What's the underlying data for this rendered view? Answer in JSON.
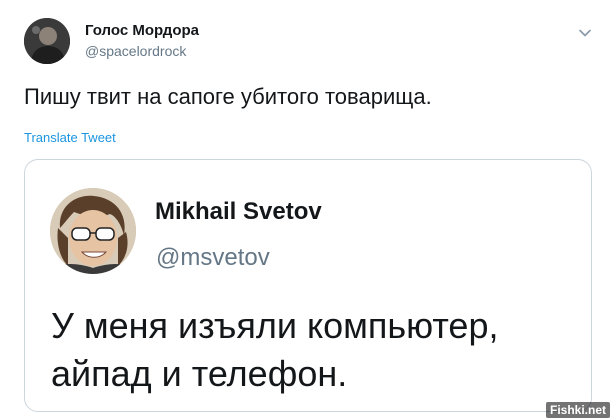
{
  "tweet": {
    "author_name": "Голос Мордора",
    "author_handle": "@spacelordrock",
    "text": "Пишу твит на сапоге убитого товарища.",
    "translate_label": "Translate Tweet",
    "menu_icon": "chevron-down-icon",
    "avatar_icon": "user-avatar"
  },
  "quoted_tweet": {
    "author_name": "Mikhail Svetov",
    "author_handle": "@msvetov",
    "text_lines": [
      "У меня изъяли компьютер,",
      "айпад и телефон."
    ],
    "avatar_icon": "user-avatar"
  },
  "watermark": "Fishki.net",
  "colors": {
    "text": "#14171a",
    "secondary": "#657786",
    "link": "#1b95e0",
    "border": "#ccd6dd"
  }
}
